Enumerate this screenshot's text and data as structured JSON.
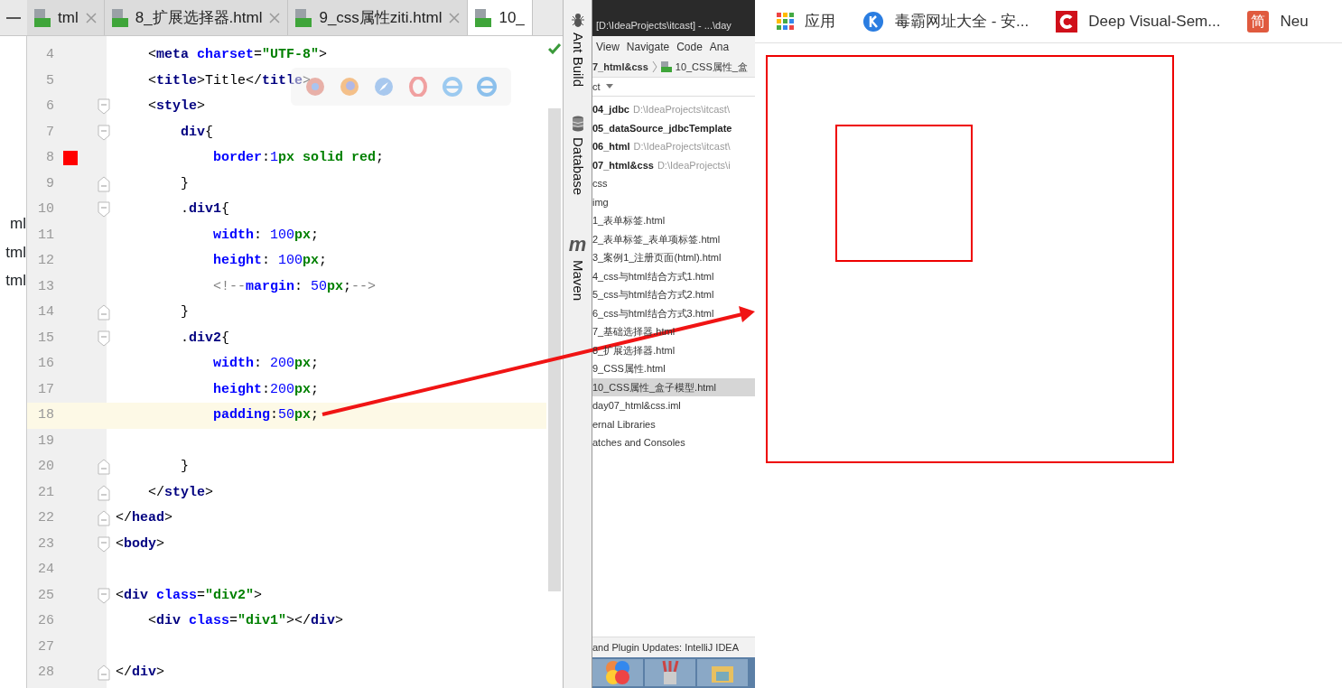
{
  "editor_tabs": [
    {
      "label": "tml",
      "selected": false
    },
    {
      "label": "8_扩展选择器.html",
      "selected": false
    },
    {
      "label": "9_css属性ziti.html",
      "selected": false
    },
    {
      "label": "10_",
      "selected": true
    }
  ],
  "project_panel": {
    "items": [
      "ml",
      "tml",
      "tml"
    ]
  },
  "code_lines": [
    {
      "number": "4",
      "kind": "plain",
      "breakpoint": false,
      "current": false,
      "tokens": [
        {
          "kind": "punct",
          "text": "    <"
        },
        {
          "kind": "tag",
          "text": "meta"
        },
        {
          "kind": "attr",
          "text": " charset"
        },
        {
          "kind": "punct",
          "text": "="
        },
        {
          "kind": "string",
          "text": "\"UTF-8\""
        },
        {
          "kind": "punct",
          "text": ">"
        }
      ]
    },
    {
      "number": "5",
      "kind": "plain",
      "breakpoint": false,
      "current": false,
      "tokens": [
        {
          "kind": "punct",
          "text": "    <"
        },
        {
          "kind": "tag",
          "text": "title"
        },
        {
          "kind": "punct",
          "text": ">"
        },
        {
          "kind": "text",
          "text": "Title"
        },
        {
          "kind": "punct",
          "text": "</"
        },
        {
          "kind": "tag",
          "text": "title"
        },
        {
          "kind": "punct",
          "text": ">"
        }
      ]
    },
    {
      "number": "6",
      "kind": "foldstart",
      "breakpoint": false,
      "current": false,
      "tokens": [
        {
          "kind": "punct",
          "text": "    <"
        },
        {
          "kind": "tag",
          "text": "style"
        },
        {
          "kind": "punct",
          "text": ">"
        }
      ]
    },
    {
      "number": "7",
      "kind": "foldstart",
      "breakpoint": false,
      "current": false,
      "tokens": [
        {
          "kind": "selector",
          "text": "        div"
        },
        {
          "kind": "punct",
          "text": "{"
        }
      ]
    },
    {
      "number": "8",
      "kind": "plain",
      "breakpoint": true,
      "current": false,
      "tokens": [
        {
          "kind": "property",
          "text": "            border"
        },
        {
          "kind": "punct",
          "text": ":"
        },
        {
          "kind": "number",
          "text": "1"
        },
        {
          "kind": "unit",
          "text": "px solid red"
        },
        {
          "kind": "punct",
          "text": ";"
        }
      ]
    },
    {
      "number": "9",
      "kind": "foldend",
      "breakpoint": false,
      "current": false,
      "tokens": [
        {
          "kind": "punct",
          "text": "        }"
        }
      ]
    },
    {
      "number": "10",
      "kind": "foldstart",
      "breakpoint": false,
      "current": false,
      "tokens": [
        {
          "kind": "punct",
          "text": "        ."
        },
        {
          "kind": "selector",
          "text": "div1"
        },
        {
          "kind": "punct",
          "text": "{"
        }
      ]
    },
    {
      "number": "11",
      "kind": "plain",
      "breakpoint": false,
      "current": false,
      "tokens": [
        {
          "kind": "property",
          "text": "            width"
        },
        {
          "kind": "punct",
          "text": ": "
        },
        {
          "kind": "number",
          "text": "100"
        },
        {
          "kind": "unit",
          "text": "px"
        },
        {
          "kind": "punct",
          "text": ";"
        }
      ]
    },
    {
      "number": "12",
      "kind": "plain",
      "breakpoint": false,
      "current": false,
      "tokens": [
        {
          "kind": "property",
          "text": "            height"
        },
        {
          "kind": "punct",
          "text": ": "
        },
        {
          "kind": "number",
          "text": "100"
        },
        {
          "kind": "unit",
          "text": "px"
        },
        {
          "kind": "punct",
          "text": ";"
        }
      ]
    },
    {
      "number": "13",
      "kind": "plain",
      "breakpoint": false,
      "current": false,
      "tokens": [
        {
          "kind": "comment",
          "text": "            <!--"
        },
        {
          "kind": "property",
          "text": "margin"
        },
        {
          "kind": "punct",
          "text": ": "
        },
        {
          "kind": "number",
          "text": "50"
        },
        {
          "kind": "unit",
          "text": "px"
        },
        {
          "kind": "punct",
          "text": ";"
        },
        {
          "kind": "comment",
          "text": "-->"
        }
      ]
    },
    {
      "number": "14",
      "kind": "foldend",
      "breakpoint": false,
      "current": false,
      "tokens": [
        {
          "kind": "punct",
          "text": "        }"
        }
      ]
    },
    {
      "number": "15",
      "kind": "foldstart",
      "breakpoint": false,
      "current": false,
      "tokens": [
        {
          "kind": "punct",
          "text": "        ."
        },
        {
          "kind": "selector",
          "text": "div2"
        },
        {
          "kind": "punct",
          "text": "{"
        }
      ]
    },
    {
      "number": "16",
      "kind": "plain",
      "breakpoint": false,
      "current": false,
      "tokens": [
        {
          "kind": "property",
          "text": "            width"
        },
        {
          "kind": "punct",
          "text": ": "
        },
        {
          "kind": "number",
          "text": "200"
        },
        {
          "kind": "unit",
          "text": "px"
        },
        {
          "kind": "punct",
          "text": ";"
        }
      ]
    },
    {
      "number": "17",
      "kind": "plain",
      "breakpoint": false,
      "current": false,
      "tokens": [
        {
          "kind": "property",
          "text": "            height"
        },
        {
          "kind": "punct",
          "text": ":"
        },
        {
          "kind": "number",
          "text": "200"
        },
        {
          "kind": "unit",
          "text": "px"
        },
        {
          "kind": "punct",
          "text": ";"
        }
      ]
    },
    {
      "number": "18",
      "kind": "plain",
      "breakpoint": false,
      "current": true,
      "tokens": [
        {
          "kind": "property",
          "text": "            padding"
        },
        {
          "kind": "punct",
          "text": ":"
        },
        {
          "kind": "number",
          "text": "50"
        },
        {
          "kind": "unit",
          "text": "px"
        },
        {
          "kind": "punct",
          "text": ";"
        }
      ]
    },
    {
      "number": "19",
      "kind": "plain",
      "breakpoint": false,
      "current": false
    },
    {
      "number": "20",
      "kind": "foldend",
      "breakpoint": false,
      "current": false,
      "tokens": [
        {
          "kind": "punct",
          "text": "        }"
        }
      ]
    },
    {
      "number": "21",
      "kind": "foldend",
      "breakpoint": false,
      "current": false,
      "tokens": [
        {
          "kind": "punct",
          "text": "    </"
        },
        {
          "kind": "tag",
          "text": "style"
        },
        {
          "kind": "punct",
          "text": ">"
        }
      ]
    },
    {
      "number": "22",
      "kind": "foldend",
      "breakpoint": false,
      "current": false,
      "tokens": [
        {
          "kind": "punct",
          "text": "</"
        },
        {
          "kind": "tag",
          "text": "head"
        },
        {
          "kind": "punct",
          "text": ">"
        }
      ]
    },
    {
      "number": "23",
      "kind": "foldstart",
      "breakpoint": false,
      "current": false,
      "tokens": [
        {
          "kind": "punct",
          "text": "<"
        },
        {
          "kind": "tag",
          "text": "body"
        },
        {
          "kind": "punct",
          "text": ">"
        }
      ]
    },
    {
      "number": "24",
      "kind": "plain",
      "breakpoint": false,
      "current": false
    },
    {
      "number": "25",
      "kind": "foldstart",
      "breakpoint": false,
      "current": false,
      "tokens": [
        {
          "kind": "punct",
          "text": "<"
        },
        {
          "kind": "tag",
          "text": "div"
        },
        {
          "kind": "attr",
          "text": " class"
        },
        {
          "kind": "punct",
          "text": "="
        },
        {
          "kind": "string",
          "text": "\"div2\""
        },
        {
          "kind": "punct",
          "text": ">"
        }
      ]
    },
    {
      "number": "26",
      "kind": "plain",
      "breakpoint": false,
      "current": false,
      "tokens": [
        {
          "kind": "punct",
          "text": "    <"
        },
        {
          "kind": "tag",
          "text": "div"
        },
        {
          "kind": "attr",
          "text": " class"
        },
        {
          "kind": "punct",
          "text": "="
        },
        {
          "kind": "string",
          "text": "\"div1\""
        },
        {
          "kind": "punct",
          "text": "></"
        },
        {
          "kind": "tag",
          "text": "div"
        },
        {
          "kind": "punct",
          "text": ">"
        }
      ]
    },
    {
      "number": "27",
      "kind": "plain",
      "breakpoint": false,
      "current": false
    },
    {
      "number": "28",
      "kind": "foldend",
      "breakpoint": false,
      "current": false,
      "tokens": [
        {
          "kind": "punct",
          "text": "</"
        },
        {
          "kind": "tag",
          "text": "div"
        },
        {
          "kind": "punct",
          "text": ">"
        }
      ]
    }
  ],
  "tool_windows": [
    {
      "label": "Ant Build",
      "kind": "ant"
    },
    {
      "label": "Database",
      "kind": "database"
    },
    {
      "label": "Maven",
      "kind": "maven",
      "icon_text": "m"
    }
  ],
  "ide_screenshot": {
    "title": "[D:\\IdeaProjects\\itcast] - ...\\day",
    "menu": [
      "View",
      "Navigate",
      "Code",
      "Ana"
    ],
    "breadcrumb": [
      "7_html&css",
      "10_CSS属性_盒"
    ],
    "project_selector": "ct",
    "tree": [
      {
        "text": "04_jdbc",
        "detail": "D:\\IdeaProjects\\itcast\\",
        "bold": true,
        "selected": false
      },
      {
        "text": "05_dataSource_jdbcTemplate",
        "bold": true,
        "selected": false
      },
      {
        "text": "06_html",
        "detail": "D:\\IdeaProjects\\itcast\\",
        "bold": true,
        "selected": false
      },
      {
        "text": "07_html&css",
        "detail": "D:\\IdeaProjects\\i",
        "bold": true,
        "selected": false
      },
      {
        "text": "css",
        "bold": false,
        "selected": false
      },
      {
        "text": "img",
        "bold": false,
        "selected": false
      },
      {
        "text": "1_表单标签.html",
        "bold": false,
        "selected": false
      },
      {
        "text": "2_表单标签_表单项标签.html",
        "bold": false,
        "selected": false
      },
      {
        "text": "3_案例1_注册页面(html).html",
        "bold": false,
        "selected": false
      },
      {
        "text": "4_css与html结合方式1.html",
        "bold": false,
        "selected": false
      },
      {
        "text": "5_css与html结合方式2.html",
        "bold": false,
        "selected": false
      },
      {
        "text": "6_css与html结合方式3.html",
        "bold": false,
        "selected": false
      },
      {
        "text": "7_基础选择器.html",
        "bold": false,
        "selected": false
      },
      {
        "text": "8_扩展选择器.html",
        "bold": false,
        "selected": false
      },
      {
        "text": "9_CSS属性.html",
        "bold": false,
        "selected": false
      },
      {
        "text": "10_CSS属性_盒子模型.html",
        "bold": false,
        "selected": true
      },
      {
        "text": "day07_html&css.iml",
        "bold": false,
        "selected": false
      },
      {
        "text": "ernal Libraries",
        "bold": false,
        "selected": false
      },
      {
        "text": "atches and Consoles",
        "bold": false,
        "selected": false
      }
    ],
    "status": "and Plugin Updates: IntelliJ IDEA"
  },
  "bookmarks": [
    {
      "label": "应用",
      "kind": "apps"
    },
    {
      "label": "毒霸网址大全 - 安...",
      "kind": "k"
    },
    {
      "label": "Deep Visual-Sem...",
      "kind": "c"
    },
    {
      "label": "Neu",
      "kind": "jian",
      "icon_text": "简"
    }
  ]
}
